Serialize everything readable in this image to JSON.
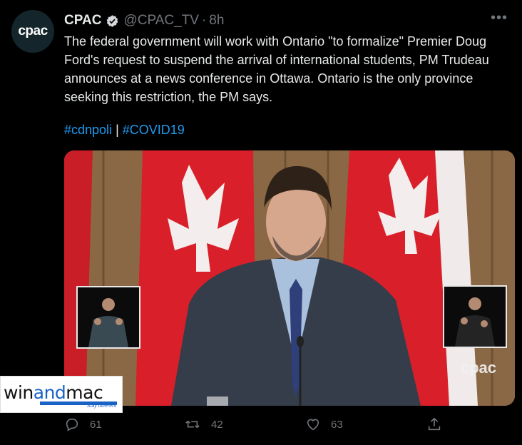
{
  "tweet": {
    "avatar_text": "cpac",
    "display_name": "CPAC",
    "handle": "@CPAC_TV",
    "separator": "·",
    "time": "8h",
    "text": "The federal government will work with Ontario \"to formalize\" Premier Doug Ford's request to suspend the arrival of international students, PM Trudeau announces at a news conference in Ottawa. Ontario is the only province seeking this restriction, the PM says.",
    "hashtag1": "#cdnpoli",
    "hashtag_sep": " | ",
    "hashtag2": "#COVID19"
  },
  "media": {
    "watermark": "cpac"
  },
  "overlay_logo": {
    "brand_pre": "win",
    "brand_and": "and",
    "brand_post": "mac",
    "tagline": "Stay different"
  },
  "actions": {
    "reply_count": "61",
    "retweet_count": "42",
    "like_count": "63"
  },
  "icons": [
    "verified-badge-icon",
    "more-icon",
    "reply-icon",
    "retweet-icon",
    "like-icon",
    "share-icon"
  ],
  "colors": {
    "link": "#1d9bf0",
    "muted": "#71767b",
    "background": "#000000"
  }
}
